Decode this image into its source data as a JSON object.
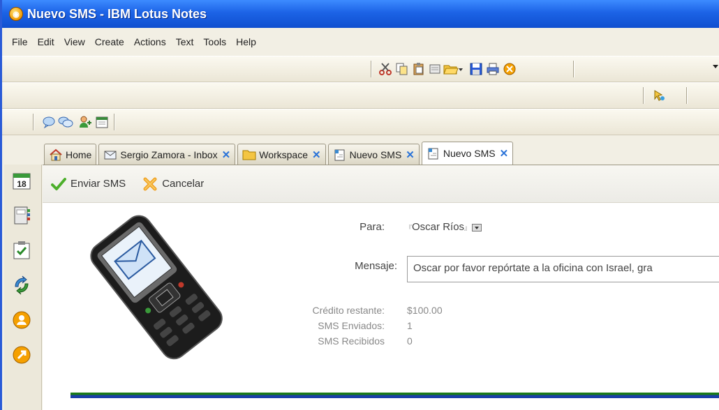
{
  "window": {
    "title": "Nuevo SMS - IBM Lotus Notes"
  },
  "menu": [
    "File",
    "Edit",
    "View",
    "Create",
    "Actions",
    "Text",
    "Tools",
    "Help"
  ],
  "tabs": [
    {
      "label": "Home",
      "icon": "home-icon"
    },
    {
      "label": "Sergio Zamora - Inbox",
      "icon": "inbox-icon"
    },
    {
      "label": "Workspace",
      "icon": "folder-icon"
    },
    {
      "label": "Nuevo SMS",
      "icon": "form-icon"
    },
    {
      "label": "Nuevo SMS",
      "icon": "form-icon",
      "active": true
    }
  ],
  "sidebar": {
    "calendar_day": "18",
    "icons": [
      "calendar-icon",
      "contacts-icon",
      "todo-icon",
      "replicate-icon",
      "people-icon",
      "sametime-icon"
    ]
  },
  "actions": {
    "send": "Enviar SMS",
    "cancel": "Cancelar"
  },
  "form": {
    "to_label": "Para:",
    "to_value": "Oscar Ríos",
    "message_label": "Mensaje:",
    "message_value": "Oscar por favor repórtate a la oficina con Israel, gra",
    "credit_label": "Crédito restante:",
    "credit_value": "$100.00",
    "sent_label": "SMS Enviados:",
    "sent_value": "1",
    "received_label": "SMS Recibidos",
    "received_value": "0"
  },
  "colors": {
    "title_bar": "#1c63e6",
    "footer_green": "#1a7a1a",
    "footer_blue": "#1a3fa8",
    "tab_close": "#2a73d8"
  }
}
